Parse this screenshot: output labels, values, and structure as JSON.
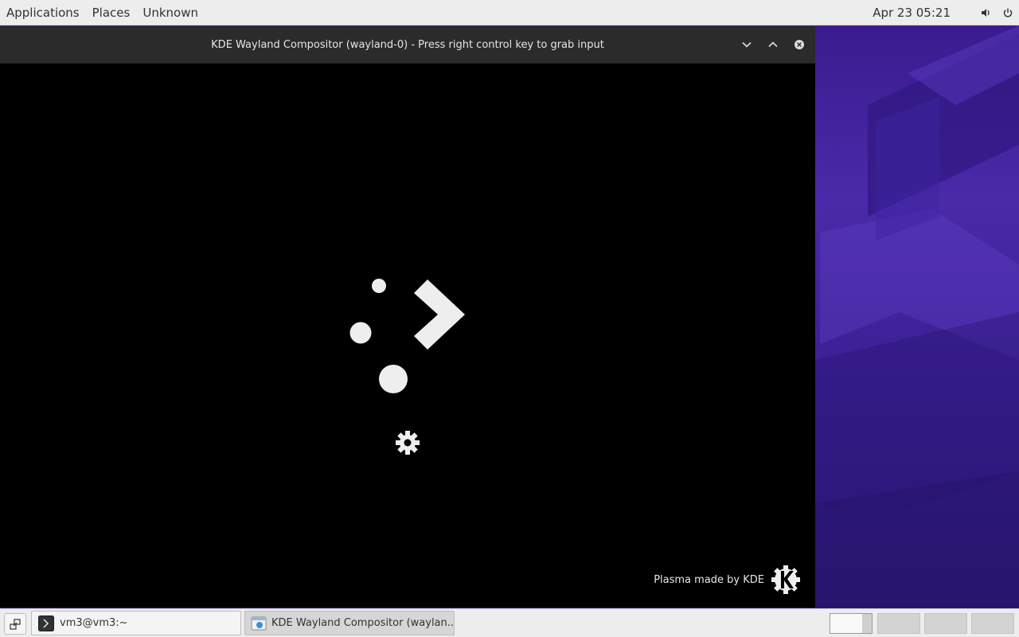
{
  "top_panel": {
    "menus": [
      "Applications",
      "Places",
      "Unknown"
    ],
    "clock": "Apr 23  05:21",
    "tray_icons": [
      "volume-icon",
      "power-icon"
    ]
  },
  "window": {
    "title": "KDE Wayland Compositor (wayland-0) - Press right control key to grab input",
    "controls": [
      "minimize",
      "maximize",
      "close"
    ],
    "splash": {
      "footer_text": "Plasma made by KDE",
      "progress_icon": "gear-icon"
    }
  },
  "taskbar": {
    "tasks": [
      {
        "label": "vm3@vm3:~",
        "icon": "terminal-icon"
      },
      {
        "label": "KDE Wayland Compositor (waylan...",
        "icon": "kde-window-icon"
      }
    ],
    "workspaces_count": 4,
    "active_workspace": 1
  },
  "colors": {
    "panel_bg": "#ededed",
    "titlebar_bg": "#2b2b2b",
    "splash_bg": "#000000",
    "wallpaper_accent": "#4a2aa8"
  }
}
